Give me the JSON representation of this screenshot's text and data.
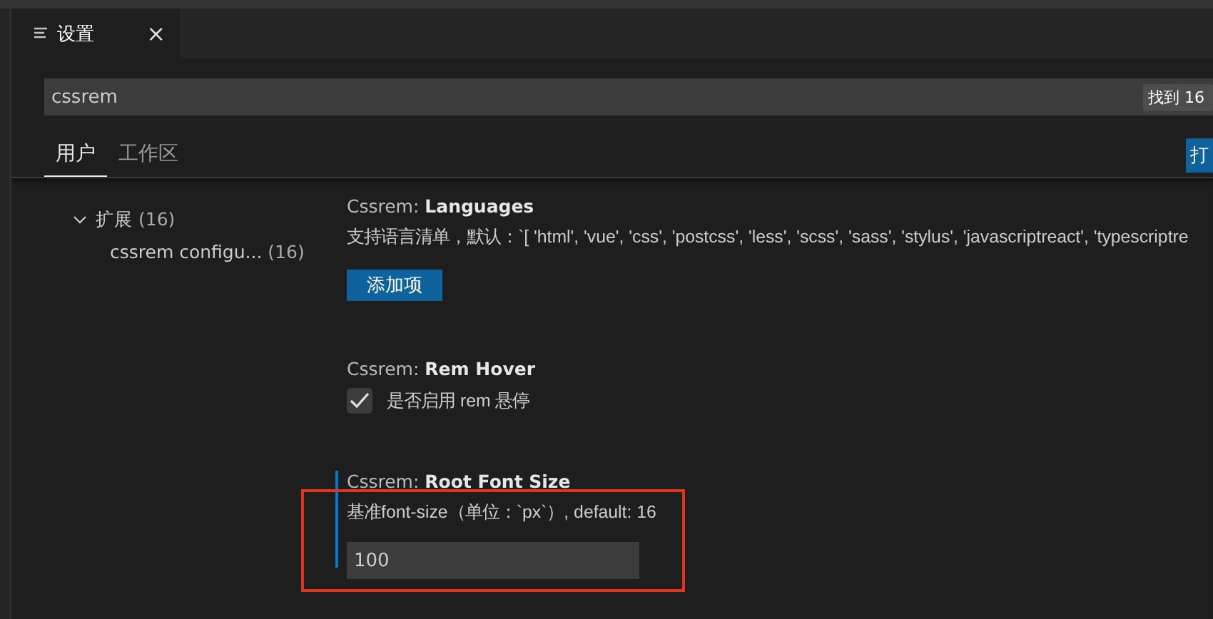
{
  "editor_tab": {
    "title": "设置",
    "close": "×"
  },
  "search": {
    "value": "cssrem",
    "result_badge": "找到 16"
  },
  "scope_tabs": [
    {
      "label": "用户",
      "selected": true
    },
    {
      "label": "工作区",
      "selected": false
    }
  ],
  "open_button": "打",
  "toc": [
    {
      "label": "扩展",
      "count": "(16)",
      "expanded": true,
      "children": [
        {
          "label": "cssrem configu...",
          "count": "(16)"
        }
      ]
    }
  ],
  "settings": [
    {
      "kind": "list",
      "title": "Cssrem: **Languages**",
      "description": "支持语言清单，默认：`[ 'html', 'vue', 'css', 'postcss', 'less', 'scss', 'sass', 'stylus', 'javascriptreact', 'typescriptre",
      "button": "添加项"
    },
    {
      "kind": "checkbox",
      "title": "Cssrem: **Rem Hover**",
      "description": "是否启用 rem 悬停",
      "checked": true
    },
    {
      "kind": "number",
      "title": "Cssrem: **Root Font Size**",
      "description": "基准font-size（单位：`px`）, default: 16",
      "value": "100",
      "focused": true,
      "annotated": true
    }
  ]
}
